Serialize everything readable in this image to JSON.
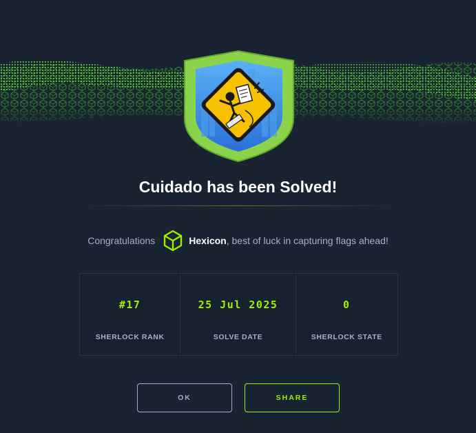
{
  "dialog": {
    "title": "Cuidado has been Solved!",
    "congrats_prefix": "Congratulations",
    "username": "Hexicon",
    "congrats_suffix": ", best of luck in capturing flags ahead!"
  },
  "stats": [
    {
      "value": "#17",
      "label": "SHERLOCK RANK"
    },
    {
      "value": "25 Jul 2025",
      "label": "SOLVE DATE"
    },
    {
      "value": "0",
      "label": "SHERLOCK STATE"
    }
  ],
  "buttons": {
    "ok_label": "OK",
    "share_label": "SHARE"
  },
  "colors": {
    "background": "#1a2332",
    "accent": "#9fef00",
    "muted_text": "#a4b1cd",
    "badge_green": "#8bd34a",
    "sign_yellow": "#f7c100"
  },
  "icons": {
    "badge": "sherlock-hazard-badge",
    "avatar": "green-cube-icon"
  }
}
